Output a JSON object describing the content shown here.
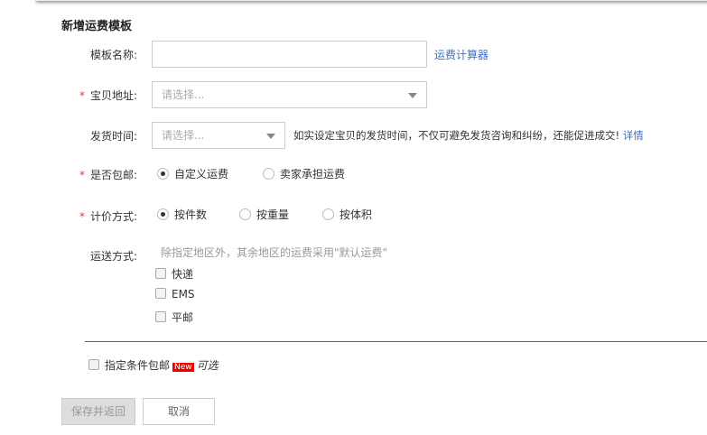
{
  "title": "新增运费模板",
  "template_name": {
    "label": "模板名称:",
    "value": "",
    "link": "运费计算器"
  },
  "address": {
    "label": "宝贝地址:",
    "placeholder": "请选择..."
  },
  "ship_time": {
    "label": "发货时间:",
    "placeholder": "请选择...",
    "hint": "如实设定宝贝的发货时间，不仅可避免发货咨询和纠纷，还能促进成交!",
    "link": "详情"
  },
  "free_shipping": {
    "label": "是否包邮:",
    "options": [
      "自定义运费",
      "卖家承担运费"
    ],
    "selected": 0
  },
  "pricing": {
    "label": "计价方式:",
    "options": [
      "按件数",
      "按重量",
      "按体积"
    ],
    "selected": 0
  },
  "delivery": {
    "label": "运送方式:",
    "hint": "除指定地区外，其余地区的运费采用\"默认运费\"",
    "options": [
      "快递",
      "EMS",
      "平邮"
    ]
  },
  "conditional": {
    "label": "指定条件包邮",
    "badge": "New",
    "optional": "可选"
  },
  "buttons": {
    "save": "保存并返回",
    "cancel": "取消"
  },
  "required_mark": "*"
}
